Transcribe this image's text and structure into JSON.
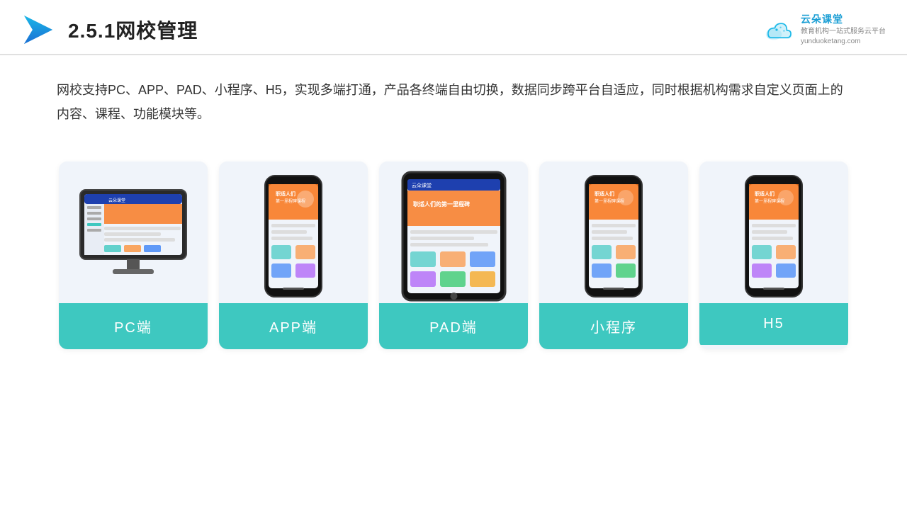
{
  "header": {
    "title": "2.5.1网校管理",
    "brand": {
      "name": "云朵课堂",
      "url": "yunduoketang.com",
      "tagline": "教育机构一站",
      "tagline2": "式服务云平台"
    }
  },
  "description": {
    "text": "网校支持PC、APP、PAD、小程序、H5，实现多端打通，产品各终端自由切换，数据同步跨平台自适应，同时根据机构需求自定义页面上的内容、课程、功能模块等。"
  },
  "cards": [
    {
      "id": "pc",
      "label": "PC端"
    },
    {
      "id": "app",
      "label": "APP端"
    },
    {
      "id": "pad",
      "label": "PAD端"
    },
    {
      "id": "miniprogram",
      "label": "小程序"
    },
    {
      "id": "h5",
      "label": "H5"
    }
  ]
}
